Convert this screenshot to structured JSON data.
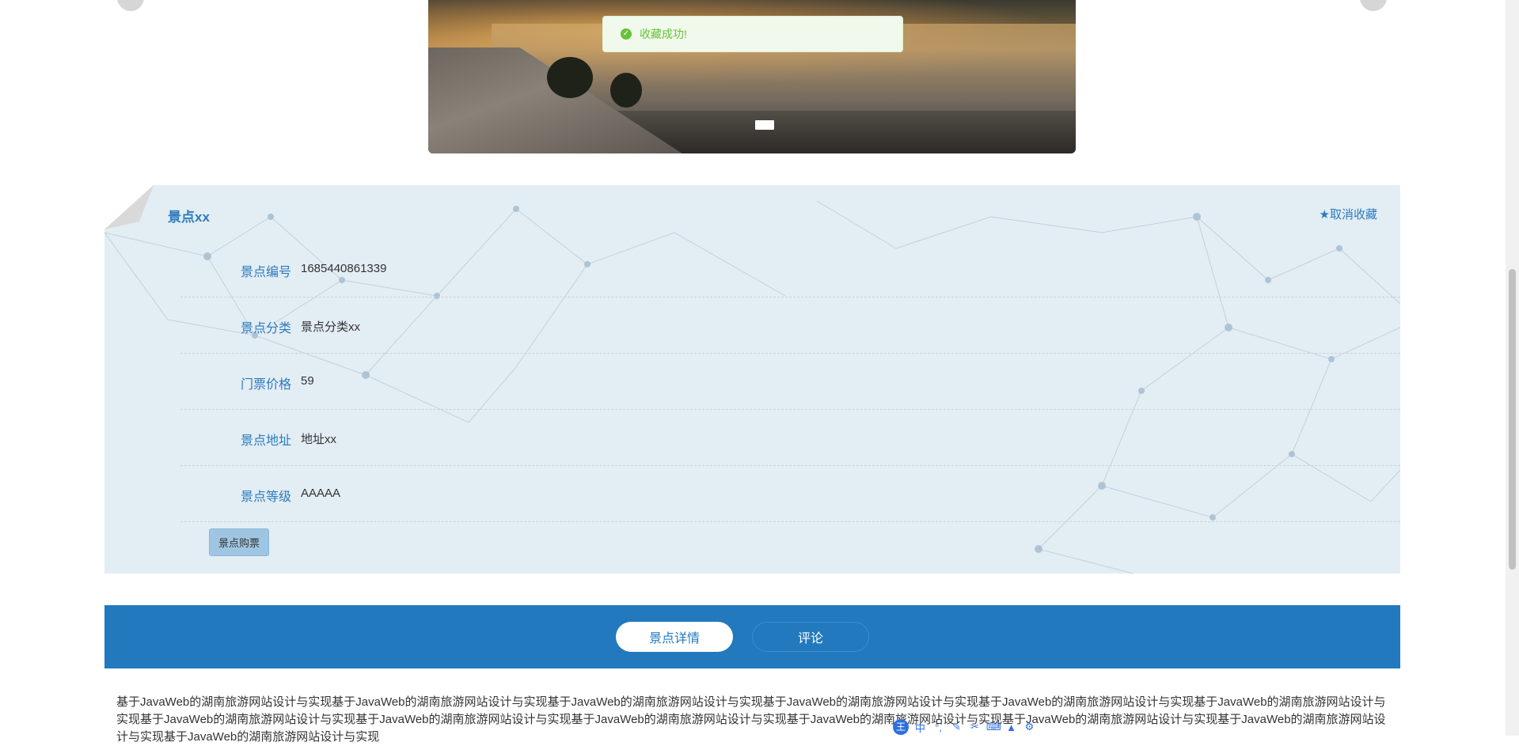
{
  "toast": {
    "icon": "check-circle-icon",
    "message": "收藏成功!"
  },
  "spot": {
    "title": "景点xx",
    "unfavorite_label": "取消收藏",
    "fields": [
      {
        "label": "景点编号",
        "value": "1685440861339"
      },
      {
        "label": "景点分类",
        "value": "景点分类xx"
      },
      {
        "label": "门票价格",
        "value": "59"
      },
      {
        "label": "景点地址",
        "value": "地址xx"
      },
      {
        "label": "景点等级",
        "value": "AAAAA"
      }
    ],
    "buy_label": "景点购票"
  },
  "tabs": [
    {
      "label": "景点详情",
      "active": true
    },
    {
      "label": "评论",
      "active": false
    }
  ],
  "description": "基于JavaWeb的湖南旅游网站设计与实现基于JavaWeb的湖南旅游网站设计与实现基于JavaWeb的湖南旅游网站设计与实现基于JavaWeb的湖南旅游网站设计与实现基于JavaWeb的湖南旅游网站设计与实现基于JavaWeb的湖南旅游网站设计与实现基于JavaWeb的湖南旅游网站设计与实现基于JavaWeb的湖南旅游网站设计与实现基于JavaWeb的湖南旅游网站设计与实现基于JavaWeb的湖南旅游网站设计与实现基于JavaWeb的湖南旅游网站设计与实现基于JavaWeb的湖南旅游网站设计与实现基于JavaWeb的湖南旅游网站设计与实现",
  "ime": {
    "logo": "王",
    "mode": "中"
  },
  "colors": {
    "accent": "#2279bd",
    "link": "#2b7bbd",
    "success": "#67c23a",
    "panel_bg": "#e3edf4"
  }
}
